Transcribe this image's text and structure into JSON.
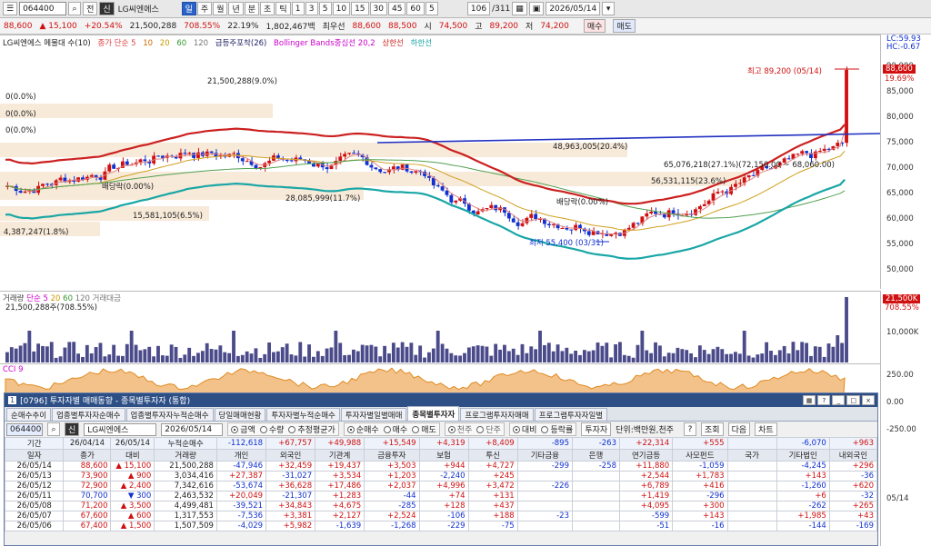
{
  "toolbar": {
    "code": "064400",
    "code_type": "전",
    "new_badge": "신",
    "stock_name": "LG씨엔에스",
    "period_buttons": [
      "일",
      "주",
      "월",
      "년",
      "분",
      "초",
      "틱",
      "1",
      "3",
      "5",
      "10",
      "15",
      "30",
      "45",
      "60",
      "5"
    ],
    "active_period": "일",
    "count": "106",
    "count_total": "/311",
    "date": "2026/05/14",
    "sell_label": "매수",
    "buy_label": "매도"
  },
  "quote": {
    "price": "88,600",
    "change": "▲ 15,100",
    "change_pct": "+20.54%",
    "volume": "21,500,288",
    "volume_pct": "708.55%",
    "turnover": "22.19%",
    "amount": "1,802,467백",
    "ask_label": "최우선",
    "ask": "88,600",
    "bid": "88,500",
    "open_label": "시",
    "open": "74,500",
    "high_label": "고",
    "high": "89,200",
    "low_label": "저",
    "low": "74,200"
  },
  "legend": {
    "title": "LG씨엔에스 메물대 수(10)",
    "ma_label": "종가 단순 5",
    "ma_periods": [
      "10",
      "20",
      "60",
      "120"
    ],
    "spike": "급등주포착(26)",
    "bollinger": "Bollinger Bands중심선 20,2",
    "upper": "상한선",
    "lower": "하한선",
    "lc": "LC:59.93",
    "hc": "HC:-0.67"
  },
  "annotations": {
    "volume_profile_1": "21,500,288(9.0%)",
    "zero_1": "0(0.0%)",
    "zero_2": "0(0.0%)",
    "zero_3": "0(0.0%)",
    "vp_2": "48,963,005(20.4%)",
    "vp_3": "65,076,218(27.1%)(72,150.00 ~ 68,060.00)",
    "vp_4": "28,085,999(11.7%)",
    "vp_5": "56,531,115(23.6%)",
    "vp_6": "15,581,105(6.5%)",
    "vp_7": "4,387,247(1.8%)",
    "marker_1": "배당락(0.00%)",
    "marker_2": "배당락(0.00%)",
    "high_label": "최고 89,200 (05/14)",
    "low_label": "최저 55,400 (03/31)"
  },
  "price_axis": {
    "current": "88,600",
    "current_pct": "19.69%",
    "ticks": [
      "90,000",
      "85,000",
      "80,000",
      "75,000",
      "70,000",
      "65,000",
      "60,000",
      "55,000",
      "50,000"
    ]
  },
  "volume_panel": {
    "label": "거래량",
    "ma_label": "단순 5",
    "ma_periods": [
      "20",
      "60",
      "120"
    ],
    "amount_label": "거래대금",
    "last": "21,500,288주(708.55%)",
    "axis_current": "21,500K",
    "axis_pct": "708.55%",
    "axis_tick": "10,000K"
  },
  "cci_panel": {
    "label": "CCI 9",
    "ticks": [
      "250.00",
      "0.00",
      "-250.00"
    ],
    "date_tag": "05/14"
  },
  "window": {
    "title": "[0796] 투자자별 매매동향 - 종목별투자자 (통합)",
    "tabs": [
      "순매수추이",
      "업종별투자자순매수",
      "업종별투자자누적순매수",
      "당일매매현황",
      "투자자별누적순매수",
      "투자자별일별매매",
      "종목별투자자",
      "프로그램투자자매매",
      "프로그램투자자일별"
    ],
    "active_tab": "종목별투자자",
    "code": "064400",
    "badge": "신",
    "name": "LG씨엔에스",
    "date": "2026/05/14",
    "radio_group_1": [
      "금액",
      "수량",
      "추정평균가"
    ],
    "radio_group_2": [
      "순매수",
      "매수",
      "매도"
    ],
    "radio_group_3": [
      "천주",
      "단주"
    ],
    "radio_group_4": [
      "대비",
      "등락률"
    ],
    "investor_button": "투자자",
    "unit": "단위:백만원,천주",
    "help": "?",
    "query": "조회",
    "next": "다음",
    "chart": "차트",
    "period_label": "기간",
    "from": "26/04/14",
    "to": "26/05/14",
    "cum_label": "누적순매수",
    "totals": [
      "-112,618",
      "+67,757",
      "+49,988",
      "+15,549",
      "+4,319",
      "+8,409",
      "-895",
      "-263",
      "+22,314",
      "+555",
      "",
      "-6,070",
      "+963"
    ],
    "headers": [
      "일자",
      "종가",
      "대비",
      "거래량",
      "개인",
      "외국인",
      "기관계",
      "금융투자",
      "보험",
      "투신",
      "기타금융",
      "은행",
      "연기금등",
      "사모펀드",
      "국가",
      "기타법인",
      "내외국인"
    ],
    "rows": [
      [
        "26/05/14",
        "88,600",
        "▲ 15,100",
        "21,500,288",
        "-47,946",
        "+32,459",
        "+19,437",
        "+3,503",
        "+944",
        "+4,727",
        "-299",
        "-258",
        "+11,880",
        "-1,059",
        "",
        "-4,245",
        "+296"
      ],
      [
        "26/05/13",
        "73,900",
        "▲ 900",
        "3,034,416",
        "+27,387",
        "-31,027",
        "+3,534",
        "+1,203",
        "-2,240",
        "+245",
        "",
        "",
        "+2,544",
        "+1,783",
        "",
        "+143",
        "-36"
      ],
      [
        "26/05/12",
        "72,900",
        "▲ 2,400",
        "7,342,616",
        "-53,674",
        "+36,628",
        "+17,486",
        "+2,037",
        "+4,996",
        "+3,472",
        "-226",
        "",
        "+6,789",
        "+416",
        "",
        "-1,260",
        "+620"
      ],
      [
        "26/05/11",
        "70,700",
        "▼ 300",
        "2,463,532",
        "+20,049",
        "-21,307",
        "+1,283",
        "-44",
        "+74",
        "+131",
        "",
        "",
        "+1,419",
        "-296",
        "",
        "+6",
        "-32"
      ],
      [
        "26/05/08",
        "71,200",
        "▲ 3,500",
        "4,499,481",
        "-39,521",
        "+34,843",
        "+4,675",
        "-285",
        "+128",
        "+437",
        "",
        "",
        "+4,095",
        "+300",
        "",
        "-262",
        "+265"
      ],
      [
        "26/05/07",
        "67,600",
        "▲ 600",
        "1,317,553",
        "-7,536",
        "+3,381",
        "+2,127",
        "+2,524",
        "-106",
        "+188",
        "-23",
        "",
        "-599",
        "+143",
        "",
        "+1,985",
        "+43"
      ],
      [
        "26/05/06",
        "67,400",
        "▲ 1,500",
        "1,507,509",
        "-4,029",
        "+5,982",
        "-1,639",
        "-1,268",
        "-229",
        "-75",
        "",
        "",
        "-51",
        "-16",
        "",
        "-144",
        "-169"
      ]
    ]
  },
  "colors": {
    "up": "#d01010",
    "down": "#1030d0",
    "accent": "#2a62c8",
    "bb": "#1aa6a6",
    "ma": "#cc2020"
  }
}
